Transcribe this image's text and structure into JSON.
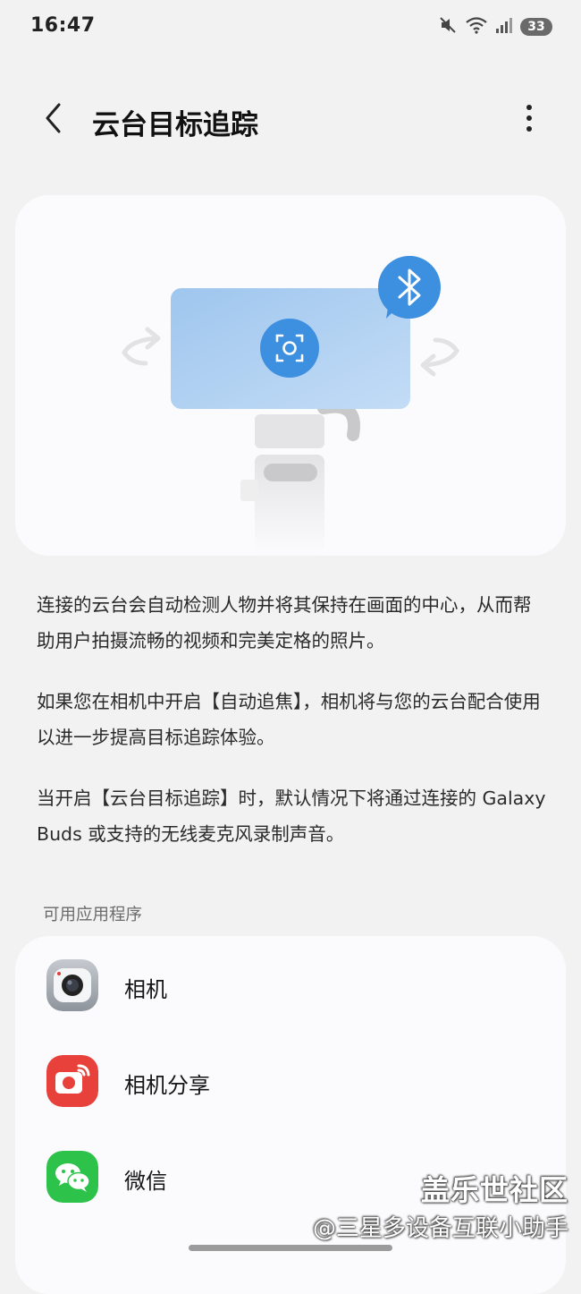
{
  "status_bar": {
    "time": "16:47",
    "battery": "33",
    "icons": [
      "mute-icon",
      "wifi-icon",
      "signal-icon",
      "battery-icon"
    ]
  },
  "header": {
    "title": "云台目标追踪",
    "back_icon": "chevron-left-icon",
    "more_icon": "more-vertical-icon"
  },
  "illustration": {
    "icons": [
      "bluetooth-icon",
      "focus-target-icon",
      "rotate-left-arrow-icon",
      "rotate-right-arrow-icon"
    ],
    "accent_color": "#3d8fe0",
    "screen_color": "#a9cdf2"
  },
  "description": {
    "paragraphs": [
      "连接的云台会自动检测人物并将其保持在画面的中心，从而帮助用户拍摄流畅的视频和完美定格的照片。",
      "如果您在相机中开启【自动追焦】，相机将与您的云台配合使用以进一步提高目标追踪体验。",
      "当开启【云台目标追踪】时，默认情况下将通过连接的 Galaxy Buds 或支持的无线麦克风录制声音。"
    ]
  },
  "available_apps": {
    "section_title": "可用应用程序",
    "items": [
      {
        "label": "相机",
        "icon": "camera-app-icon",
        "color": "#9aa0a8"
      },
      {
        "label": "相机分享",
        "icon": "camera-share-app-icon",
        "color": "#e8403a"
      },
      {
        "label": "微信",
        "icon": "wechat-app-icon",
        "color": "#2dc24a"
      }
    ]
  },
  "watermark": {
    "title": "盖乐世社区",
    "subtitle": "@三星多设备互联小助手"
  }
}
